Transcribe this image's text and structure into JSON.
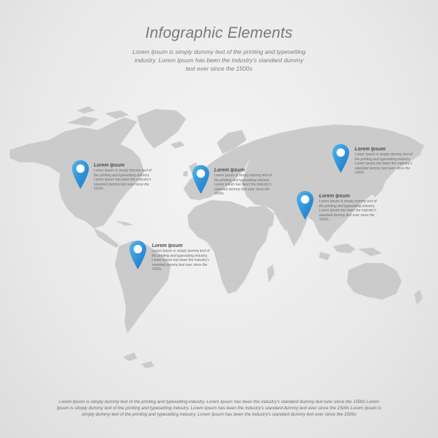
{
  "header": {
    "title": "Infographic Elements",
    "subtitle": "Lorem Ipsum is simply dummy text of the printing and typesetting industry. Lorem Ipsum has been the industry's standard dummy text ever since the 1500s"
  },
  "colors": {
    "map_fill": "#cfcfcf",
    "pin_light": "#4fb6ec",
    "pin_dark": "#1a73c6",
    "pin_center": "#ffffff"
  },
  "markers": [
    {
      "title": "Lorem Ipsum",
      "text": "Lorem Ipsum is simply dummy text of the printing and typesetting industry. Lorem Ipsum has been the industry's standard dummy text ever since the 1500s",
      "icon": "map-pin-icon"
    },
    {
      "title": "Lorem Ipsum",
      "text": "Lorem Ipsum is simply dummy text of the printing and typesetting industry. Lorem Ipsum has been the industry's standard dummy text ever since the 1500s",
      "icon": "map-pin-icon"
    },
    {
      "title": "Lorem Ipsum",
      "text": "Lorem Ipsum is simply dummy text of the printing and typesetting industry. Lorem Ipsum has been the industry's standard dummy text ever since the 1500s",
      "icon": "map-pin-icon"
    },
    {
      "title": "Lorem Ipsum",
      "text": "Lorem Ipsum is simply dummy text of the printing and typesetting industry. Lorem Ipsum has been the industry's standard dummy text ever since the 1500s",
      "icon": "map-pin-icon"
    },
    {
      "title": "Lorem Ipsum",
      "text": "Lorem Ipsum is simply dummy text of the printing and typesetting industry. Lorem Ipsum has been the industry's standard dummy text ever since the 1500s",
      "icon": "map-pin-icon"
    }
  ],
  "footer": {
    "text": "Lorem Ipsum is simply dummy text of the printing and typesetting industry. Lorem Ipsum has been the industry's standard dummy text ever since the 1500s Lorem Ipsum is simply dummy text of the printing and typesetting industry. Lorem Ipsum has been the industry's standard dummy text ever since the 1500s Lorem Ipsum is simply dummy text of the printing and typesetting industry. Lorem Ipsum has been the industry's standard dummy text ever since the 1500s"
  }
}
